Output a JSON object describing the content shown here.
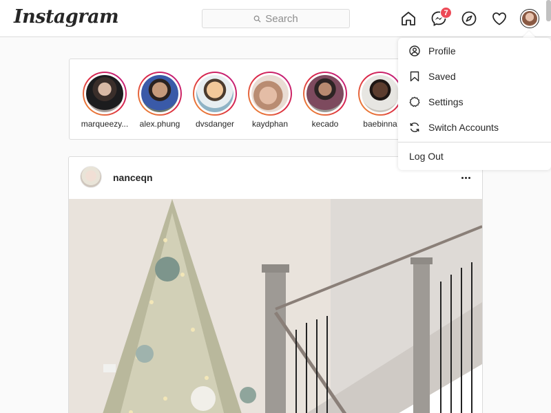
{
  "header": {
    "logo": "Instagram",
    "search_placeholder": "Search",
    "messages_badge": "7"
  },
  "stories": [
    {
      "name": "marqueezy..."
    },
    {
      "name": "alex.phung"
    },
    {
      "name": "dvsdanger"
    },
    {
      "name": "kaydphan"
    },
    {
      "name": "kecado"
    },
    {
      "name": "baebinna"
    }
  ],
  "post": {
    "username": "nanceqn"
  },
  "menu": {
    "items": [
      {
        "label": "Profile",
        "icon": "profile-icon"
      },
      {
        "label": "Saved",
        "icon": "bookmark-icon"
      },
      {
        "label": "Settings",
        "icon": "settings-icon"
      },
      {
        "label": "Switch Accounts",
        "icon": "switch-icon"
      }
    ],
    "logout": "Log Out"
  }
}
